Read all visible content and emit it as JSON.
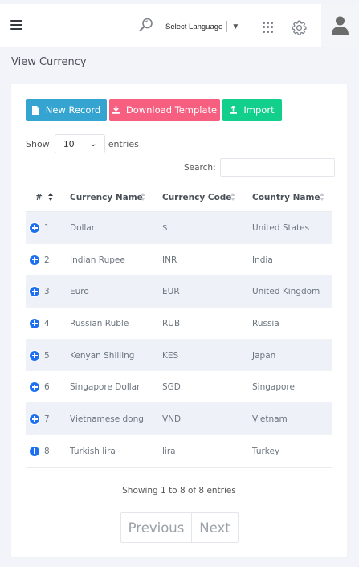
{
  "header": {
    "language_label": "Select Language",
    "language_arrow": "▼"
  },
  "page": {
    "title": "View Currency"
  },
  "toolbar": {
    "new_record": "New Record",
    "download_template": "Download Template",
    "import": "Import"
  },
  "length": {
    "show": "Show",
    "value": "10",
    "entries": "entries"
  },
  "search": {
    "label": "Search:",
    "value": ""
  },
  "table": {
    "headers": [
      "#",
      "Currency Name",
      "Currency Code",
      "Country Name"
    ],
    "rows": [
      {
        "num": "1",
        "name": "Dollar",
        "code": "$",
        "country": "United States"
      },
      {
        "num": "2",
        "name": "Indian Rupee",
        "code": "INR",
        "country": "India"
      },
      {
        "num": "3",
        "name": "Euro",
        "code": "EUR",
        "country": "United Kingdom"
      },
      {
        "num": "4",
        "name": "Russian Ruble",
        "code": "RUB",
        "country": "Russia"
      },
      {
        "num": "5",
        "name": "Kenyan Shilling",
        "code": "KES",
        "country": "Japan"
      },
      {
        "num": "6",
        "name": "Singapore Dollar",
        "code": "SGD",
        "country": "Singapore"
      },
      {
        "num": "7",
        "name": "Vietnamese dong",
        "code": "VND",
        "country": "Vietnam"
      },
      {
        "num": "8",
        "name": "Turkish lira",
        "code": "lira",
        "country": "Turkey"
      }
    ]
  },
  "footer": {
    "info": "Showing 1 to 8 of 8 entries",
    "previous": "Previous",
    "next": "Next"
  },
  "colors": {
    "new_record": "#35a4d1",
    "download_template": "#f75f80",
    "import": "#13cf8c",
    "expand_icon": "#1d6ff2",
    "striped_row": "#eef1f8"
  }
}
